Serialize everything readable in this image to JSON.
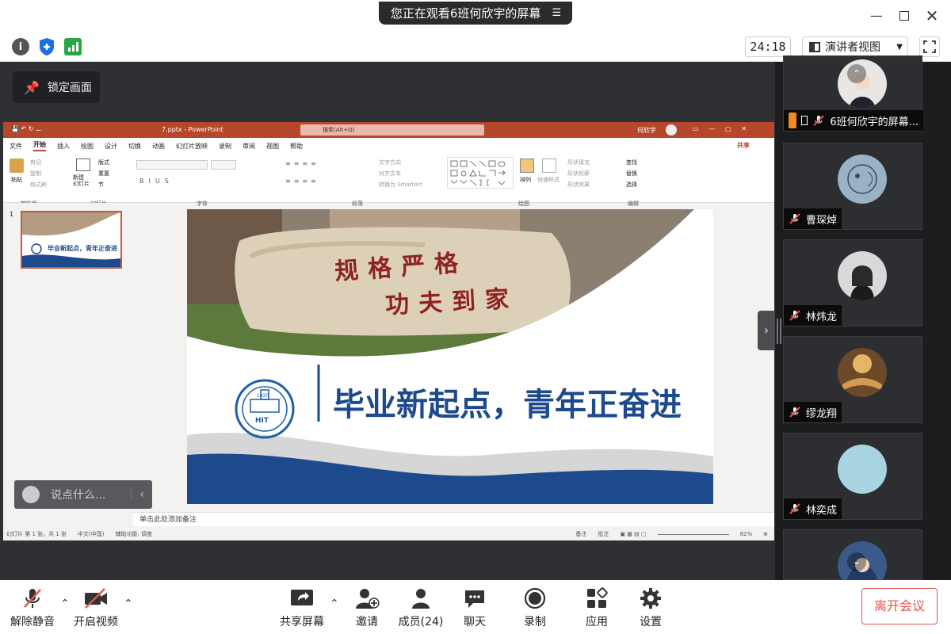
{
  "window": {
    "share_banner": "您正在观看6班何欣宇的屏幕",
    "menu_icon": "menu-lines-icon",
    "controls": [
      "minimize-icon",
      "maximize-icon",
      "close-icon"
    ]
  },
  "status": {
    "timer": "24:18",
    "view_mode": "演讲者视图",
    "icons": [
      "info-icon",
      "shield-icon",
      "signal-icon"
    ]
  },
  "main": {
    "lock_label": "锁定画面",
    "chat_placeholder": "说点什么..."
  },
  "ppt": {
    "filename": "7.pptx  -  PowerPoint",
    "search": "搜索(Alt+Q)",
    "user": "何欣宇",
    "share_label": "共享",
    "tabs": [
      "文件",
      "开始",
      "插入",
      "绘图",
      "设计",
      "切换",
      "动画",
      "幻灯片放映",
      "录制",
      "审阅",
      "视图",
      "帮助"
    ],
    "groups": [
      "剪贴板",
      "幻灯片",
      "字体",
      "段落",
      "绘图",
      "编辑"
    ],
    "ribbon_labels": {
      "paste": "粘贴",
      "cut": "剪切",
      "copy": "复制",
      "format_painter": "格式刷",
      "new_slide": "新建\n幻灯片",
      "layout": "版式",
      "reset": "重置",
      "section": "节",
      "text_direction": "文字方向",
      "align_text": "对齐文本",
      "smartart": "转换为 SmartArt",
      "arrange": "排列",
      "quick_styles": "快速样式",
      "shape_fill": "形状填充",
      "shape_outline": "形状轮廓",
      "shape_effects": "形状效果",
      "find": "查找",
      "replace": "替换",
      "select": "选择"
    },
    "slide_number": "1",
    "slide": {
      "calligraphy_line1": "规格严格",
      "calligraphy_line2": "功夫到家",
      "headline": "毕业新起点，青年正奋进",
      "logo_text": "HIT",
      "logo_year": "1920"
    },
    "notes": "单击此处添加备注",
    "statusbar": {
      "slide_info": "幻灯片 第 1 张，共 1 张",
      "language": "中文(中国)",
      "accessibility": "辅助功能: 调查",
      "notes_btn": "备注",
      "comments_btn": "批注",
      "zoom": "82%"
    }
  },
  "participants": [
    {
      "name": "6班何欣宇的屏幕...",
      "sharing": true
    },
    {
      "name": "曹琛焯",
      "sharing": false
    },
    {
      "name": "林炜龙",
      "sharing": false
    },
    {
      "name": "缪龙翔",
      "sharing": false
    },
    {
      "name": "林奕成",
      "sharing": false
    },
    {
      "name": "",
      "sharing": false
    }
  ],
  "toolbar": {
    "unmute": "解除静音",
    "start_video": "开启视频",
    "share_screen": "共享屏幕",
    "invite": "邀请",
    "members": "成员(24)",
    "chat": "聊天",
    "record": "录制",
    "apps": "应用",
    "settings": "设置",
    "leave": "离开会议"
  }
}
